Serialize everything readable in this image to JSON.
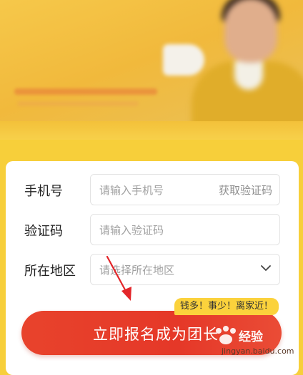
{
  "form": {
    "phone": {
      "label": "手机号",
      "placeholder": "请输入手机号",
      "code_button": "获取验证码"
    },
    "code": {
      "label": "验证码",
      "placeholder": "请输入验证码"
    },
    "region": {
      "label": "所在地区",
      "placeholder": "请选择所在地区"
    }
  },
  "badge": "钱多！事少！离家近！",
  "cta": {
    "label": "立即报名成为团长"
  },
  "watermark": {
    "brand": "经验",
    "url": "jingyan.baidu.com"
  },
  "colors": {
    "accent": "#e53828",
    "badge": "#fbd23c",
    "background": "#f7cf3a"
  }
}
